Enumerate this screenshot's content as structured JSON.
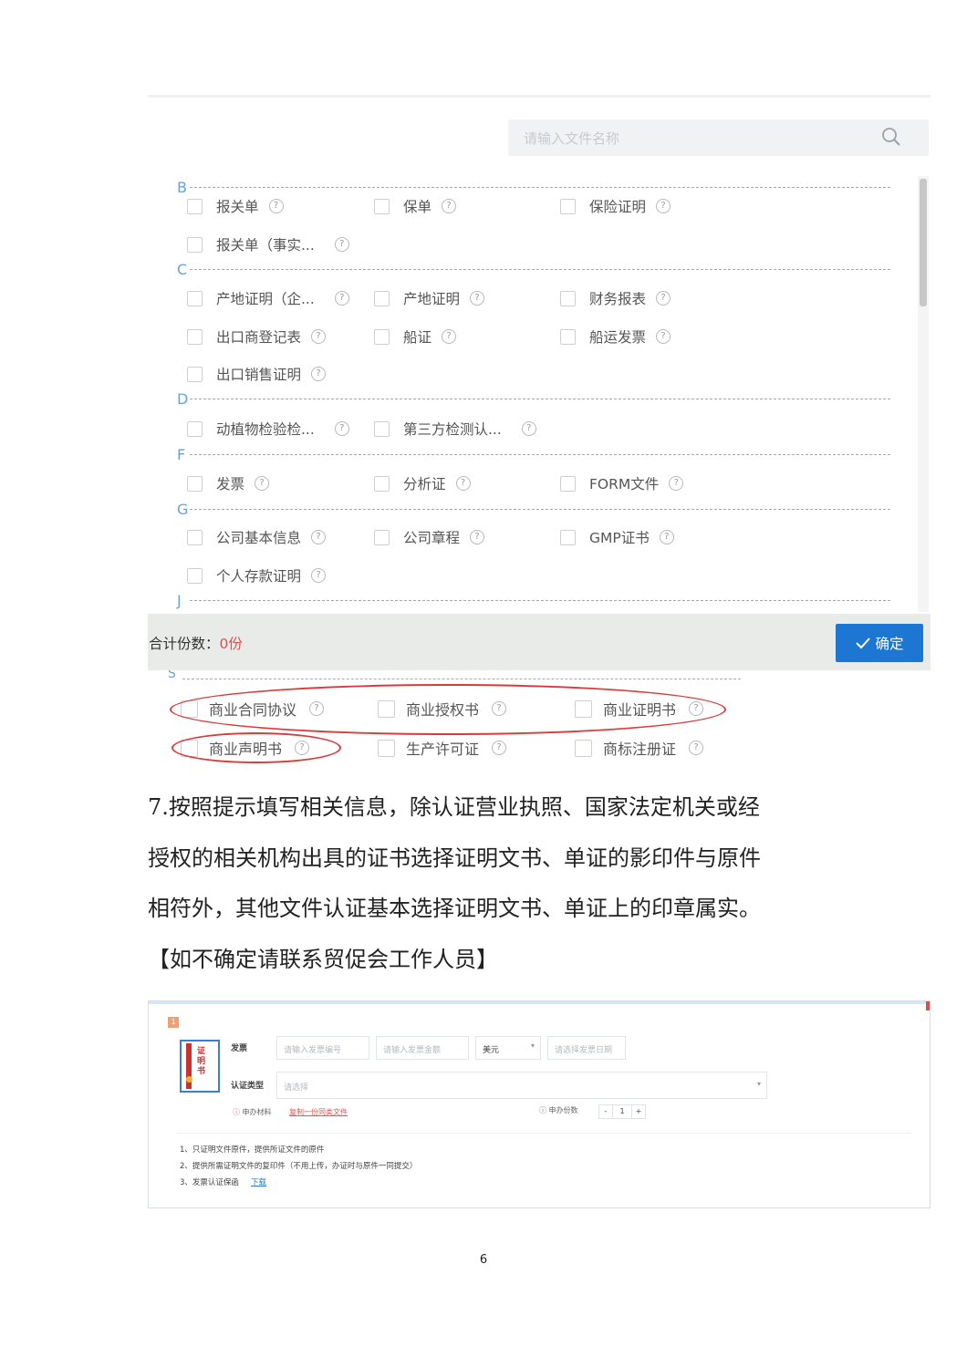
{
  "search": {
    "placeholder": "请输入文件名称"
  },
  "sections": [
    {
      "letter": "B",
      "items": [
        "报关单",
        "保单",
        "保险证明",
        "报关单（事实..."
      ]
    },
    {
      "letter": "C",
      "items": [
        "产地证明（企...",
        "产地证明",
        "财务报表",
        "出口商登记表",
        "船证",
        "船运发票",
        "出口销售证明"
      ]
    },
    {
      "letter": "D",
      "items": [
        "动植物检验检...",
        "第三方检测认..."
      ]
    },
    {
      "letter": "F",
      "items": [
        "发票",
        "分析证",
        "FORM文件"
      ]
    },
    {
      "letter": "G",
      "items": [
        "公司基本信息",
        "公司章程",
        "GMP证书",
        "个人存款证明"
      ]
    },
    {
      "letter": "J",
      "items": []
    }
  ],
  "footer": {
    "total_label": "合计份数：",
    "total_value": "0份",
    "confirm_label": "确定"
  },
  "lower": {
    "letter": "S",
    "items": [
      "商业合同协议",
      "商业授权书",
      "商业证明书",
      "商业声明书",
      "生产许可证",
      "商标注册证"
    ]
  },
  "paragraph": [
    "7.按照提示填写相关信息，除认证营业执照、国家法定机关或经",
    "授权的相关机构出具的证书选择证明文书、单证的影印件与原件",
    "相符外，其他文件认证基本选择证明文书、单证上的印章属实。",
    "【如不确定请联系贸促会工作人员】"
  ],
  "form": {
    "index": "1",
    "badge_text": "证明书",
    "invoice_label": "发票",
    "invoice_no_placeholder": "请输入发票编号",
    "invoice_amount_placeholder": "请输入发票金额",
    "currency": "美元",
    "invoice_date_placeholder": "请选择发票日期",
    "cert_type_label": "认证类型",
    "cert_type_placeholder": "请选择",
    "materials_label": "申办材料",
    "copy_link": "复制一份同类文件",
    "copies_label": "申办份数",
    "copies_value": "1",
    "minus": "-",
    "plus": "+",
    "notes": [
      "1、只证明文件原件，提供所证文件的原件",
      "2、提供所需证明文件的复印件（不用上传，办证时与原件一同提交）",
      "3、发票认证保函"
    ],
    "download_link": "下载"
  },
  "page_number": "6"
}
